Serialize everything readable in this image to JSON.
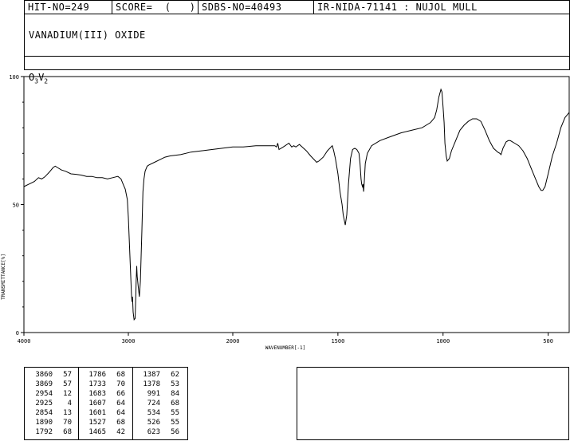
{
  "header": {
    "hit_no": "HIT-NO=249",
    "score": "SCORE=  (   )",
    "sdbs_no": "SDBS-NO=40493",
    "source": "IR-NIDA-71141 : NUJOL MULL"
  },
  "compound_name": "VANADIUM(III) OXIDE",
  "formula": {
    "parts": [
      [
        "O",
        "3"
      ],
      [
        "V",
        "2"
      ]
    ]
  },
  "chart_data": {
    "type": "line",
    "xlabel": "WAVENUMBER[-1]",
    "ylabel": "TRANSMITTANCE[%]",
    "xlim": [
      4000,
      400
    ],
    "ylim": [
      0,
      100
    ],
    "x_ticks": [
      4000,
      3000,
      2000,
      1500,
      1000,
      500
    ],
    "y_ticks": [
      0,
      50,
      100
    ],
    "series": [
      {
        "points": [
          [
            4000,
            57
          ],
          [
            3950,
            58
          ],
          [
            3900,
            59
          ],
          [
            3860,
            60.5
          ],
          [
            3830,
            60
          ],
          [
            3800,
            60.8
          ],
          [
            3760,
            62.5
          ],
          [
            3720,
            64.5
          ],
          [
            3700,
            65
          ],
          [
            3680,
            64.5
          ],
          [
            3640,
            63.5
          ],
          [
            3600,
            63
          ],
          [
            3550,
            62
          ],
          [
            3500,
            61.8
          ],
          [
            3450,
            61.5
          ],
          [
            3400,
            61
          ],
          [
            3350,
            61
          ],
          [
            3300,
            60.5
          ],
          [
            3250,
            60.5
          ],
          [
            3200,
            60
          ],
          [
            3150,
            60.5
          ],
          [
            3100,
            61
          ],
          [
            3070,
            60
          ],
          [
            3050,
            58
          ],
          [
            3030,
            56
          ],
          [
            3010,
            52
          ],
          [
            3000,
            45
          ],
          [
            2990,
            35
          ],
          [
            2980,
            25
          ],
          [
            2970,
            15
          ],
          [
            2965,
            12
          ],
          [
            2960,
            14
          ],
          [
            2954,
            8
          ],
          [
            2945,
            5
          ],
          [
            2935,
            5.5
          ],
          [
            2928,
            15
          ],
          [
            2925,
            20
          ],
          [
            2920,
            26
          ],
          [
            2915,
            22
          ],
          [
            2905,
            18
          ],
          [
            2895,
            14
          ],
          [
            2885,
            20
          ],
          [
            2870,
            40
          ],
          [
            2860,
            55
          ],
          [
            2850,
            60
          ],
          [
            2840,
            63
          ],
          [
            2820,
            65
          ],
          [
            2800,
            65.5
          ],
          [
            2750,
            66.5
          ],
          [
            2700,
            67.5
          ],
          [
            2650,
            68.5
          ],
          [
            2600,
            69
          ],
          [
            2500,
            69.5
          ],
          [
            2400,
            70.5
          ],
          [
            2300,
            71
          ],
          [
            2200,
            71.5
          ],
          [
            2100,
            72
          ],
          [
            2000,
            72.5
          ],
          [
            1950,
            72.5
          ],
          [
            1890,
            73
          ],
          [
            1860,
            73
          ],
          [
            1800,
            73
          ],
          [
            1792,
            72.5
          ],
          [
            1786,
            74
          ],
          [
            1780,
            71.5
          ],
          [
            1760,
            72.5
          ],
          [
            1733,
            74
          ],
          [
            1720,
            72.5
          ],
          [
            1710,
            73
          ],
          [
            1700,
            72.5
          ],
          [
            1683,
            73.5
          ],
          [
            1670,
            72.5
          ],
          [
            1650,
            71
          ],
          [
            1630,
            69
          ],
          [
            1607,
            67
          ],
          [
            1601,
            66.5
          ],
          [
            1590,
            67
          ],
          [
            1570,
            68.5
          ],
          [
            1550,
            71
          ],
          [
            1527,
            73
          ],
          [
            1520,
            71
          ],
          [
            1512,
            68
          ],
          [
            1500,
            62
          ],
          [
            1490,
            55
          ],
          [
            1480,
            50
          ],
          [
            1475,
            46
          ],
          [
            1465,
            42
          ],
          [
            1458,
            46
          ],
          [
            1450,
            58
          ],
          [
            1440,
            68
          ],
          [
            1430,
            71.5
          ],
          [
            1420,
            72
          ],
          [
            1410,
            71.5
          ],
          [
            1400,
            70
          ],
          [
            1395,
            66
          ],
          [
            1390,
            60
          ],
          [
            1387,
            58
          ],
          [
            1383,
            57
          ],
          [
            1380,
            58
          ],
          [
            1378,
            55
          ],
          [
            1375,
            58
          ],
          [
            1370,
            66
          ],
          [
            1360,
            70
          ],
          [
            1340,
            73
          ],
          [
            1300,
            75
          ],
          [
            1250,
            76.5
          ],
          [
            1200,
            78
          ],
          [
            1150,
            79
          ],
          [
            1100,
            80
          ],
          [
            1080,
            81
          ],
          [
            1060,
            82
          ],
          [
            1050,
            83
          ],
          [
            1040,
            84
          ],
          [
            1030,
            87
          ],
          [
            1020,
            92
          ],
          [
            1010,
            95
          ],
          [
            1005,
            94
          ],
          [
            1000,
            88
          ],
          [
            995,
            82
          ],
          [
            991,
            74
          ],
          [
            985,
            69
          ],
          [
            980,
            67
          ],
          [
            970,
            68
          ],
          [
            960,
            71
          ],
          [
            940,
            75
          ],
          [
            920,
            79
          ],
          [
            900,
            81
          ],
          [
            880,
            82.5
          ],
          [
            860,
            83.5
          ],
          [
            840,
            83.5
          ],
          [
            820,
            82.5
          ],
          [
            800,
            79
          ],
          [
            780,
            75
          ],
          [
            760,
            72
          ],
          [
            740,
            70.5
          ],
          [
            730,
            70
          ],
          [
            724,
            69.5
          ],
          [
            715,
            72
          ],
          [
            700,
            74.5
          ],
          [
            690,
            75
          ],
          [
            680,
            75
          ],
          [
            660,
            74
          ],
          [
            640,
            73
          ],
          [
            620,
            71
          ],
          [
            600,
            68
          ],
          [
            580,
            64
          ],
          [
            560,
            60
          ],
          [
            545,
            57
          ],
          [
            534,
            55.5
          ],
          [
            526,
            55.5
          ],
          [
            515,
            57
          ],
          [
            500,
            62
          ],
          [
            480,
            69
          ],
          [
            460,
            74
          ],
          [
            440,
            80
          ],
          [
            420,
            84
          ],
          [
            410,
            85
          ],
          [
            400,
            86
          ]
        ]
      }
    ]
  },
  "peak_table": [
    [
      [
        "3860",
        "57"
      ],
      [
        "1786",
        "68"
      ],
      [
        "1387",
        "62"
      ]
    ],
    [
      [
        "3869",
        "57"
      ],
      [
        "1733",
        "70"
      ],
      [
        "1378",
        "53"
      ]
    ],
    [
      [
        "2954",
        "12"
      ],
      [
        "1683",
        "66"
      ],
      [
        "991",
        "84"
      ]
    ],
    [
      [
        "2925",
        "4"
      ],
      [
        "1607",
        "64"
      ],
      [
        "724",
        "68"
      ]
    ],
    [
      [
        "2854",
        "13"
      ],
      [
        "1601",
        "64"
      ],
      [
        "534",
        "55"
      ]
    ],
    [
      [
        "1890",
        "70"
      ],
      [
        "1527",
        "68"
      ],
      [
        "526",
        "55"
      ]
    ],
    [
      [
        "1792",
        "68"
      ],
      [
        "1465",
        "42"
      ],
      [
        "623",
        "56"
      ]
    ]
  ]
}
